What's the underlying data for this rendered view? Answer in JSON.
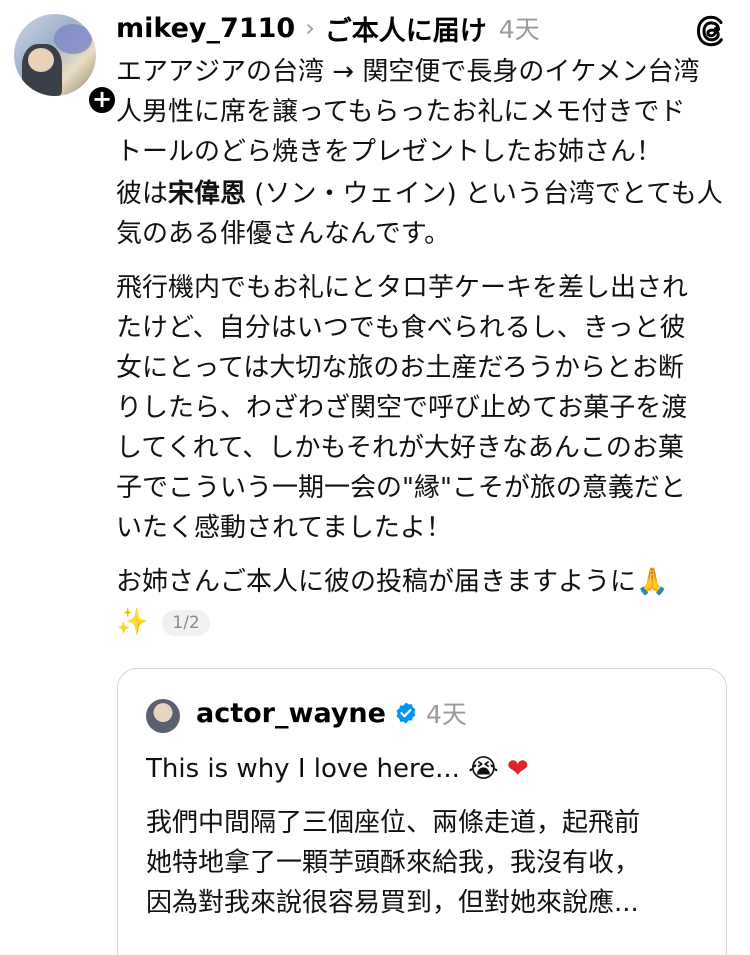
{
  "post": {
    "username": "mikey_7110",
    "reply_to": "ご本人に届け",
    "time": "4天",
    "follow_symbol": "+",
    "paragraph1": "エアアジアの台湾 → 関空便で長身のイケメン台湾\n人男性に席を譲ってもらったお礼にメモ付きでド\nトールのどら焼きをプレゼントしたお姉さん！",
    "paragraph2_pre": "彼は",
    "paragraph2_bold": "宋偉恩",
    "paragraph2_post": " (ソン・ウェイン) という台湾でとても人\n気のある俳優さんなんです。",
    "paragraph3": "飛行機内でもお礼にとタロ芋ケーキを差し出され\nたけど、自分はいつでも食べられるし、きっと彼\n女にとっては大切な旅のお土産だろうからとお断\nりしたら、わざわざ関空で呼び止めてお菓子を渡\nしてくれて、しかもそれが大好きなあんこのお菓\n子でこういう一期一会の\"縁\"こそが旅の意義だと\nいたく感動されてましたよ！",
    "paragraph4": "お姉さんご本人に彼の投稿が届きますように🙏",
    "sparkle": "✨",
    "page_counter": "1/2"
  },
  "quote": {
    "username": "actor_wayne",
    "time": "4天",
    "english": "This is why I love here...",
    "emoji_cry": "😭",
    "emoji_heart": "❤",
    "chinese": "我們中間隔了三個座位、兩條走道，起飛前\n她特地拿了一顆芋頭酥來給我，我沒有收，\n因為對我來說很容易買到，但對她來說應..."
  },
  "icons": {
    "threads": "threads-logo-icon",
    "chevron": "chevron-right-icon",
    "verified": "verified-badge-icon"
  },
  "colors": {
    "verified_blue": "#0095f6",
    "muted_gray": "#9a9a9a",
    "heart_red": "#e0242f"
  }
}
